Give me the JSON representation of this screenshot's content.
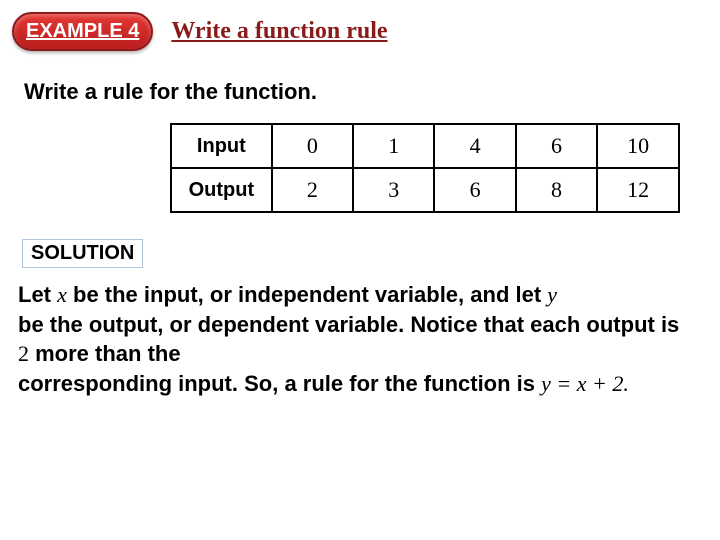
{
  "header": {
    "badge": "EXAMPLE 4",
    "title": "Write a function rule"
  },
  "prompt": "Write a rule for the function.",
  "table": {
    "row1_label": "Input",
    "row2_label": "Output",
    "inputs": [
      "0",
      "1",
      "4",
      "6",
      "10"
    ],
    "outputs": [
      "2",
      "3",
      "6",
      "8",
      "12"
    ]
  },
  "solution": {
    "label": "SOLUTION",
    "t1": "Let ",
    "x": "x",
    "t2": " be the input, or independent variable,",
    "t3": " and let ",
    "y": "y",
    "t4": " be the output, or dependent variable.",
    "t5": " Notice that each output is ",
    "two": "2",
    "t6": " more than the",
    "t7": " corresponding input.",
    "t8": " So, a rule for the function is ",
    "eq": "y = x + 2."
  },
  "chart_data": {
    "type": "table",
    "title": "Write a function rule",
    "columns": [
      "Input",
      "Output"
    ],
    "rows": [
      {
        "Input": 0,
        "Output": 2
      },
      {
        "Input": 1,
        "Output": 3
      },
      {
        "Input": 4,
        "Output": 6
      },
      {
        "Input": 6,
        "Output": 8
      },
      {
        "Input": 10,
        "Output": 12
      }
    ],
    "rule": "y = x + 2"
  }
}
